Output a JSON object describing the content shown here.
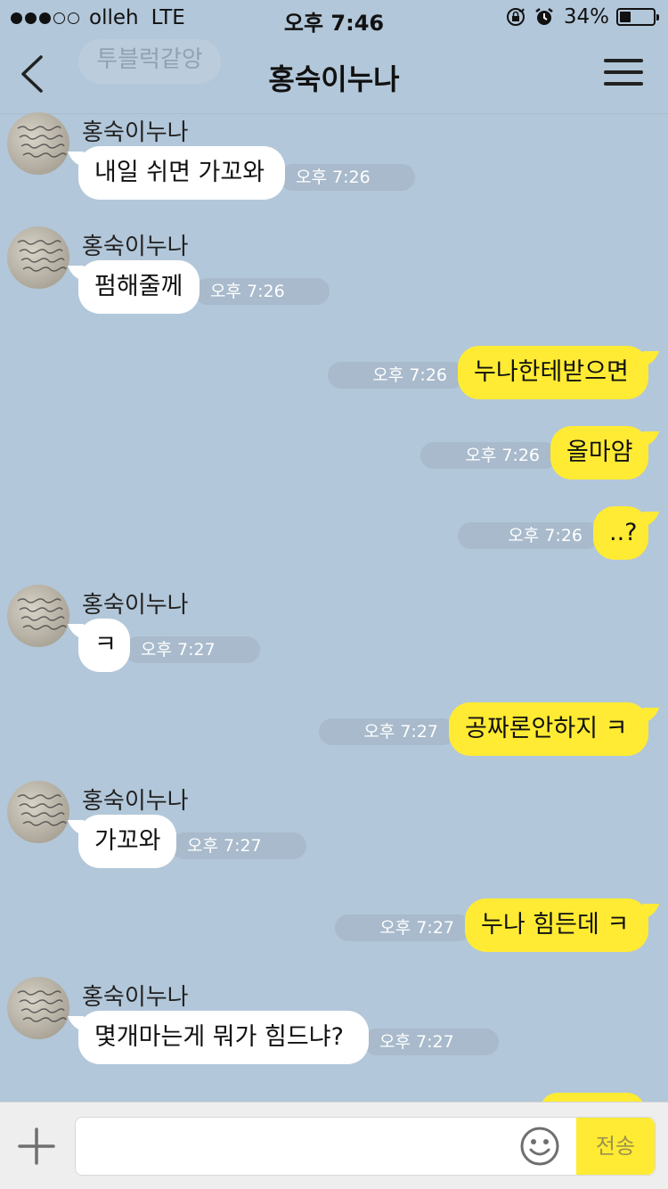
{
  "status_bar": {
    "carrier": "olleh",
    "network": "LTE",
    "time": "오후 7:46",
    "battery_percent": "34%",
    "battery_level": 0.34,
    "signal_bars": 3,
    "signal_total": 5
  },
  "header": {
    "title": "홍숙이누나",
    "ghost_tab": "투블럭같앙"
  },
  "messages": [
    {
      "direction": "in",
      "sender": "홍숙이누나",
      "text": "내일 쉬면 가꼬와",
      "time": "오후 7:26",
      "show_profile": true
    },
    {
      "direction": "in",
      "sender": "홍숙이누나",
      "text": "펌해줄께",
      "time": "오후 7:26",
      "show_profile": true
    },
    {
      "direction": "out",
      "text": "누나한테받으면",
      "time": "오후 7:26"
    },
    {
      "direction": "out",
      "text": "올마얌",
      "time": "오후 7:26"
    },
    {
      "direction": "out",
      "text": "..?",
      "time": "오후 7:26"
    },
    {
      "direction": "in",
      "sender": "홍숙이누나",
      "text": "ㅋ",
      "time": "오후 7:27",
      "show_profile": true
    },
    {
      "direction": "out",
      "text": "공짜론안하지 ㅋ",
      "time": "오후 7:27"
    },
    {
      "direction": "in",
      "sender": "홍숙이누나",
      "text": "가꼬와",
      "time": "오후 7:27",
      "show_profile": true
    },
    {
      "direction": "out",
      "text": "누나 힘든데 ㅋ",
      "time": "오후 7:27"
    },
    {
      "direction": "in",
      "sender": "홍숙이누나",
      "text": "몇개마는게 뭐가 힘드냐?",
      "time": "오후 7:27",
      "show_profile": true
    }
  ],
  "input_bar": {
    "value": "",
    "placeholder": "",
    "send_label": "전송"
  },
  "colors": {
    "chat_background": "#b2c7d9",
    "outgoing_bubble": "#ffeb33",
    "incoming_bubble": "#ffffff",
    "timestamp_pill": "#a8bacb"
  },
  "icons": [
    "back-arrow-icon",
    "menu-icon",
    "plus-icon",
    "emoji-icon",
    "rotation-lock-icon",
    "alarm-icon",
    "battery-icon"
  ]
}
